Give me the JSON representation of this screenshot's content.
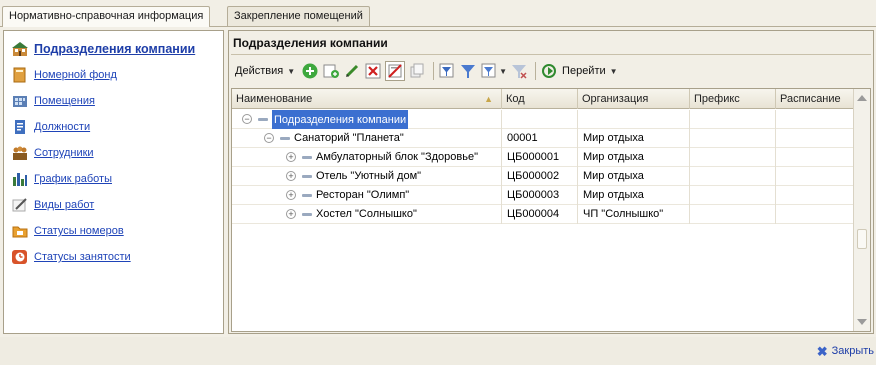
{
  "tabs": [
    {
      "label": "Нормативно-справочная информация",
      "active": true
    },
    {
      "label": "Закрепление помещений",
      "active": false
    }
  ],
  "nav": [
    {
      "label": "Подразделения компании",
      "icon": "building-icon",
      "active": true
    },
    {
      "label": "Номерной фонд",
      "icon": "room-fund-icon",
      "active": false
    },
    {
      "label": "Помещения",
      "icon": "rooms-icon",
      "active": false
    },
    {
      "label": "Должности",
      "icon": "positions-icon",
      "active": false
    },
    {
      "label": "Сотрудники",
      "icon": "employees-icon",
      "active": false
    },
    {
      "label": "График работы",
      "icon": "schedule-icon",
      "active": false
    },
    {
      "label": "Виды работ",
      "icon": "work-types-icon",
      "active": false
    },
    {
      "label": "Статусы номеров",
      "icon": "folder-icon",
      "active": false
    },
    {
      "label": "Статусы занятости",
      "icon": "status-clock-icon",
      "active": false
    }
  ],
  "panel": {
    "title": "Подразделения компании",
    "actions_label": "Действия",
    "goto_label": "Перейти"
  },
  "table": {
    "headers": {
      "name": "Наименование",
      "code": "Код",
      "org": "Организация",
      "prefix": "Префикс",
      "schedule": "Расписание"
    },
    "rows": [
      {
        "name": "Подразделения компании",
        "code": "",
        "org": "",
        "prefix": "",
        "schedule": "",
        "level": 0,
        "expanded": true,
        "selected": true
      },
      {
        "name": "Санаторий \"Планета\"",
        "code": "00001",
        "org": "Мир отдыха",
        "prefix": "",
        "schedule": "",
        "level": 1,
        "expanded": true,
        "selected": false
      },
      {
        "name": "Амбулаторный блок \"Здоровье\"",
        "code": "ЦБ000001",
        "org": "Мир отдыха",
        "prefix": "",
        "schedule": "",
        "level": 2,
        "expanded": false,
        "selected": false
      },
      {
        "name": "Отель \"Уютный дом\"",
        "code": "ЦБ000002",
        "org": "Мир отдыха",
        "prefix": "",
        "schedule": "",
        "level": 2,
        "expanded": false,
        "selected": false
      },
      {
        "name": "Ресторан \"Олимп\"",
        "code": "ЦБ000003",
        "org": "Мир отдыха",
        "prefix": "",
        "schedule": "",
        "level": 2,
        "expanded": false,
        "selected": false
      },
      {
        "name": "Хостел \"Солнышко\"",
        "code": "ЦБ000004",
        "org": "ЧП \"Солнышко\"",
        "prefix": "",
        "schedule": "",
        "level": 2,
        "expanded": false,
        "selected": false
      }
    ]
  },
  "footer": {
    "close_label": "Закрыть"
  },
  "colors": {
    "link": "#1f44b8",
    "selection": "#3b6fd0",
    "background": "#f2efe6"
  }
}
